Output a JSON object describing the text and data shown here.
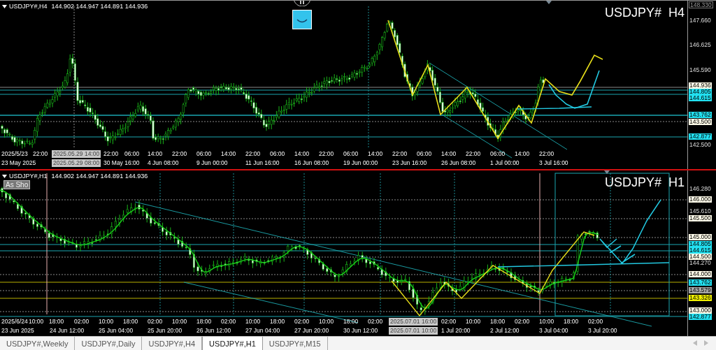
{
  "charts": [
    {
      "symbol": "USDJPY#,H4",
      "ohlc": "144.902 144.947 144.891 144.936",
      "title": "USDJPY#  H4",
      "price_labels": [
        {
          "text": "148.330",
          "kind": "frame"
        },
        {
          "text": "147.660",
          "kind": "plain"
        },
        {
          "text": "146.625",
          "kind": "plain"
        },
        {
          "text": "145.590",
          "kind": "plain"
        },
        {
          "text": "144.936",
          "kind": "white"
        },
        {
          "text": "144.805",
          "kind": "cyan"
        },
        {
          "text": "144.615",
          "kind": "cyan"
        },
        {
          "text": "143.762",
          "kind": "cyan"
        },
        {
          "text": "143.500",
          "kind": "white"
        },
        {
          "text": "142.877",
          "kind": "cyan"
        },
        {
          "text": "142.500",
          "kind": "plain"
        }
      ],
      "time_row_1": [
        {
          "text": "2025/5/23",
          "kind": "plain"
        },
        {
          "text": "22:00",
          "kind": "plain"
        },
        {
          "text": "2025.05.29 14:00",
          "kind": "cursor"
        },
        {
          "text": "22:00",
          "kind": "plain"
        },
        {
          "text": "06:00",
          "kind": "plain"
        },
        {
          "text": "14:00",
          "kind": "plain"
        },
        {
          "text": "22:00",
          "kind": "plain"
        },
        {
          "text": "06:00",
          "kind": "plain"
        },
        {
          "text": "14:00",
          "kind": "plain"
        },
        {
          "text": "22:00",
          "kind": "plain"
        },
        {
          "text": "06:00",
          "kind": "plain"
        },
        {
          "text": "14:00",
          "kind": "plain"
        },
        {
          "text": "22:00",
          "kind": "plain"
        },
        {
          "text": "06:00",
          "kind": "plain"
        },
        {
          "text": "14:00",
          "kind": "plain"
        },
        {
          "text": "22:00",
          "kind": "plain"
        },
        {
          "text": "06:00",
          "kind": "plain"
        },
        {
          "text": "14:00",
          "kind": "plain"
        },
        {
          "text": "22:00",
          "kind": "plain"
        },
        {
          "text": "06:00",
          "kind": "plain"
        },
        {
          "text": "14:00",
          "kind": "plain"
        },
        {
          "text": "22:00",
          "kind": "plain"
        }
      ],
      "time_row_2": [
        {
          "text": "23 May 2025",
          "kind": "plain"
        },
        {
          "text": "2025.05.29 08:00",
          "kind": "cursor"
        },
        {
          "text": "30 May 16:00",
          "kind": "plain"
        },
        {
          "text": "4 Jun 08:00",
          "kind": "plain"
        },
        {
          "text": "9 Jun 00:00",
          "kind": "plain"
        },
        {
          "text": "11 Jun 16:00",
          "kind": "plain"
        },
        {
          "text": "16 Jun 08:00",
          "kind": "plain"
        },
        {
          "text": "19 Jun 00:00",
          "kind": "plain"
        },
        {
          "text": "23 Jun 16:00",
          "kind": "plain"
        },
        {
          "text": "26 Jun 08:00",
          "kind": "plain"
        },
        {
          "text": "1 Jul 00:00",
          "kind": "plain"
        },
        {
          "text": "3 Jul 16:00",
          "kind": "plain"
        }
      ]
    },
    {
      "symbol": "USDJPY#,H1",
      "ohlc": "144.902 144.947 144.891 144.936",
      "title": "USDJPY#  H1",
      "button": "As Sho",
      "price_labels": [
        {
          "text": "146.280",
          "kind": "plain"
        },
        {
          "text": "146.000",
          "kind": "white"
        },
        {
          "text": "145.610",
          "kind": "plain"
        },
        {
          "text": "145.500",
          "kind": "white"
        },
        {
          "text": "145.000",
          "kind": "white"
        },
        {
          "text": "144.805",
          "kind": "cyan"
        },
        {
          "text": "144.615",
          "kind": "cyan"
        },
        {
          "text": "144.500",
          "kind": "white"
        },
        {
          "text": "144.270",
          "kind": "plain"
        },
        {
          "text": "144.000",
          "kind": "white"
        },
        {
          "text": "143.762",
          "kind": "cyan"
        },
        {
          "text": "143.579",
          "kind": "gray"
        },
        {
          "text": "143.326",
          "kind": "yellow"
        },
        {
          "text": "143.000",
          "kind": "white"
        },
        {
          "text": "142.877",
          "kind": "cyan"
        }
      ],
      "time_row_1": [
        {
          "text": "2025/6/24",
          "kind": "plain"
        },
        {
          "text": "10:00",
          "kind": "plain"
        },
        {
          "text": "18:00",
          "kind": "plain"
        },
        {
          "text": "02:00",
          "kind": "plain"
        },
        {
          "text": "10:00",
          "kind": "plain"
        },
        {
          "text": "18:00",
          "kind": "plain"
        },
        {
          "text": "02:00",
          "kind": "plain"
        },
        {
          "text": "10:00",
          "kind": "plain"
        },
        {
          "text": "18:00",
          "kind": "plain"
        },
        {
          "text": "02:00",
          "kind": "plain"
        },
        {
          "text": "10:00",
          "kind": "plain"
        },
        {
          "text": "18:00",
          "kind": "plain"
        },
        {
          "text": "02:00",
          "kind": "plain"
        },
        {
          "text": "10:00",
          "kind": "plain"
        },
        {
          "text": "18:00",
          "kind": "plain"
        },
        {
          "text": "02:00",
          "kind": "plain"
        },
        {
          "text": "2025.07.01 16:00",
          "kind": "cursor"
        },
        {
          "text": "02:00",
          "kind": "plain"
        },
        {
          "text": "10:00",
          "kind": "plain"
        },
        {
          "text": "18:00",
          "kind": "plain"
        },
        {
          "text": "02:00",
          "kind": "plain"
        },
        {
          "text": "10:00",
          "kind": "plain"
        },
        {
          "text": "18:00",
          "kind": "plain"
        },
        {
          "text": "02:00",
          "kind": "plain"
        }
      ],
      "time_row_2": [
        {
          "text": "23 Jun 2025",
          "kind": "plain"
        },
        {
          "text": "24 Jun 12:00",
          "kind": "plain"
        },
        {
          "text": "25 Jun 04:00",
          "kind": "plain"
        },
        {
          "text": "25 Jun 20:00",
          "kind": "plain"
        },
        {
          "text": "26 Jun 12:00",
          "kind": "plain"
        },
        {
          "text": "27 Jun 04:00",
          "kind": "plain"
        },
        {
          "text": "27 Jun 20:00",
          "kind": "plain"
        },
        {
          "text": "30 Jun 12:00",
          "kind": "plain"
        },
        {
          "text": "2025.07.01 10:00",
          "kind": "cursor"
        },
        {
          "text": "1 Jul 20:00",
          "kind": "plain"
        },
        {
          "text": "2 Jul 12:00",
          "kind": "plain"
        },
        {
          "text": "3 Jul 04:00",
          "kind": "plain"
        },
        {
          "text": "3 Jul 20:00",
          "kind": "plain"
        }
      ]
    }
  ],
  "tabs": [
    {
      "label": "USDJPY#,Weekly",
      "selected": false
    },
    {
      "label": "USDJPY#,Daily",
      "selected": false
    },
    {
      "label": "USDJPY#,H4",
      "selected": false
    },
    {
      "label": "USDJPY#,H1",
      "selected": true
    },
    {
      "label": "USDJPY#,M15",
      "selected": false
    }
  ]
}
